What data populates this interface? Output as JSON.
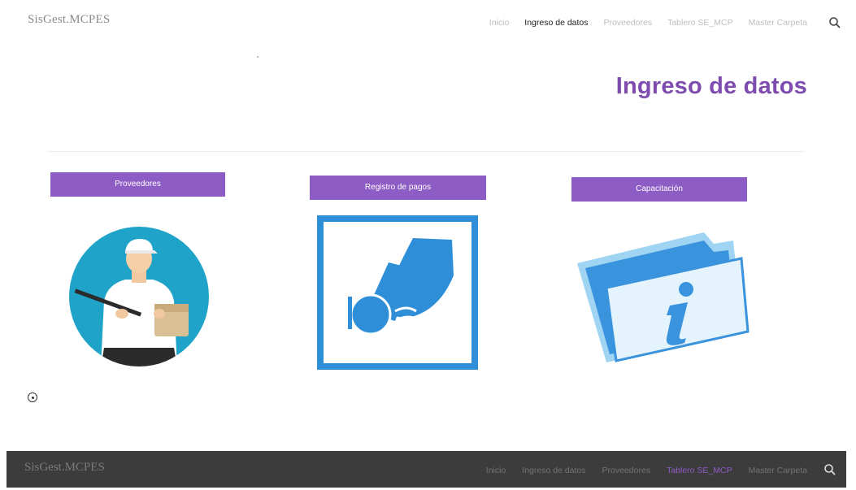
{
  "header": {
    "brand": "SisGest.MCPES",
    "nav": [
      {
        "label": "Inicio"
      },
      {
        "label": "Ingreso de datos"
      },
      {
        "label": "Proveedores"
      },
      {
        "label": "Tablero SE_MCP"
      },
      {
        "label": "Master Carpeta"
      }
    ],
    "search_icon": "search-icon"
  },
  "main": {
    "title": "Ingreso de datos",
    "cards": [
      {
        "label": "Proveedores",
        "icon": "delivery-person-icon"
      },
      {
        "label": "Registro de pagos",
        "icon": "payment-card-icon"
      },
      {
        "label": "Capacitación",
        "icon": "info-folder-icon"
      }
    ]
  },
  "footer": {
    "brand": "SisGest.MCPES",
    "nav": [
      {
        "label": "Inicio"
      },
      {
        "label": "Ingreso de datos"
      },
      {
        "label": "Proveedores"
      },
      {
        "label": "Tablero SE_MCP"
      },
      {
        "label": "Master Carpeta"
      }
    ],
    "search_icon": "search-icon"
  },
  "colors": {
    "accent": "#8d5cc4",
    "title": "#7d4cae",
    "icon_blue": "#2e8fd8",
    "footer_bg": "#3c3c3c"
  }
}
